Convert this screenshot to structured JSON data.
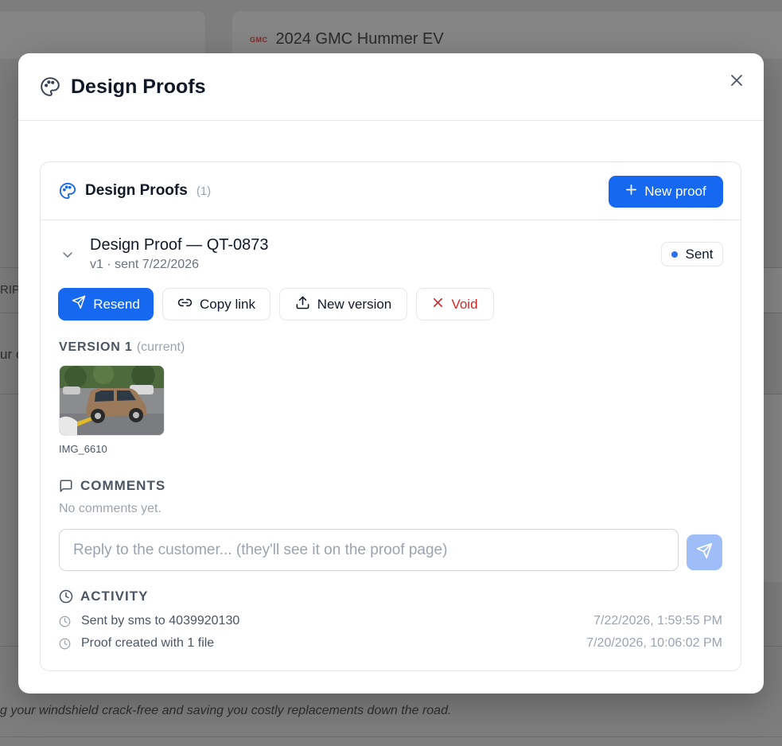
{
  "background": {
    "vehicle_brand": "GMC",
    "vehicle_name": "2024 GMC Hummer EV",
    "cut_text_1": "RIP",
    "cut_text_2": "ur c",
    "footer_text": "g your windshield crack-free and saving you costly replacements down the road."
  },
  "modal": {
    "title": "Design Proofs",
    "panel": {
      "title": "Design Proofs",
      "count": "(1)",
      "new_proof_label": "New proof"
    },
    "proof": {
      "title": "Design Proof — QT-0873",
      "subtitle": "v1 · sent 7/22/2026",
      "status": "Sent",
      "actions": {
        "resend": "Resend",
        "copy_link": "Copy link",
        "new_version": "New version",
        "void": "Void"
      },
      "version_label": "VERSION 1",
      "version_note": "(current)",
      "file_name": "IMG_6610",
      "comments_heading": "COMMENTS",
      "no_comments": "No comments yet.",
      "reply_placeholder": "Reply to the customer... (they'll see it on the proof page)",
      "activity_heading": "ACTIVITY",
      "activity": [
        {
          "text": "Sent by sms to 4039920130",
          "time": "7/22/2026, 1:59:55 PM"
        },
        {
          "text": "Proof created with 1 file",
          "time": "7/20/2026, 10:06:02 PM"
        }
      ]
    }
  },
  "colors": {
    "primary": "#1668f0",
    "danger": "#dc2626",
    "status_dot": "#2f6fed",
    "send_disabled": "#9fbdf6"
  }
}
